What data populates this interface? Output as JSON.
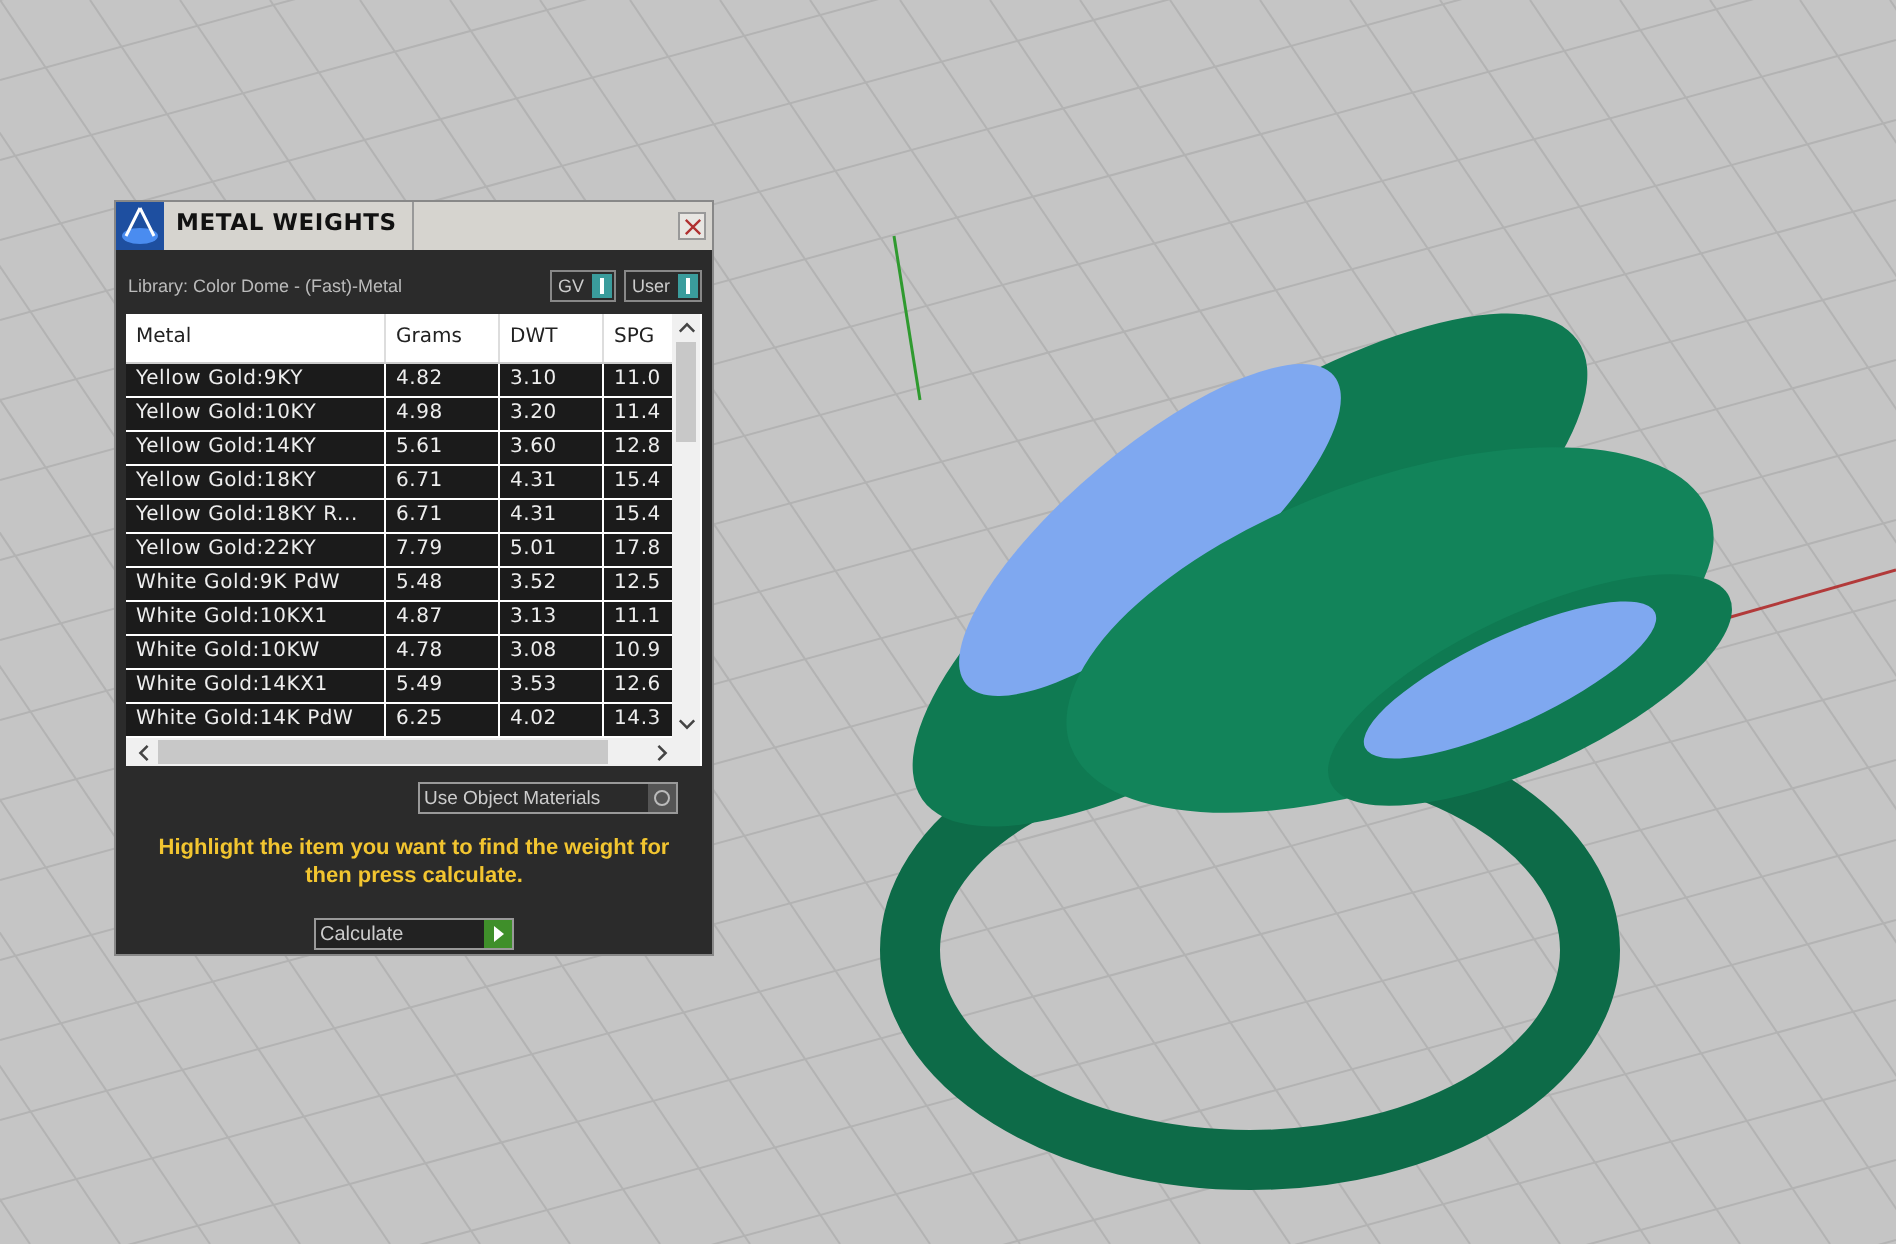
{
  "panel": {
    "title": "METAL WEIGHTS",
    "library": "Library: Color Dome - (Fast)-Metal",
    "toggles": [
      {
        "label": "GV",
        "on": true
      },
      {
        "label": "User",
        "on": true
      }
    ],
    "table": {
      "columns": [
        "Metal",
        "Grams",
        "DWT",
        "SPG"
      ],
      "rows": [
        {
          "metal": "Yellow Gold:9KY",
          "grams": "4.82",
          "dwt": "3.10",
          "spg": "11.0",
          "selected": false
        },
        {
          "metal": "Yellow Gold:10KY",
          "grams": "4.98",
          "dwt": "3.20",
          "spg": "11.4",
          "selected": false
        },
        {
          "metal": "Yellow Gold:14KY",
          "grams": "5.61",
          "dwt": "3.60",
          "spg": "12.8",
          "selected": false
        },
        {
          "metal": "Yellow Gold:18KY",
          "grams": "6.71",
          "dwt": "4.31",
          "spg": "15.4",
          "selected": false
        },
        {
          "metal": "Yellow Gold:18KY R...",
          "grams": "6.71",
          "dwt": "4.31",
          "spg": "15.4",
          "selected": false
        },
        {
          "metal": "Yellow Gold:22KY",
          "grams": "7.79",
          "dwt": "5.01",
          "spg": "17.8",
          "selected": false
        },
        {
          "metal": "White Gold:9K PdW",
          "grams": "5.48",
          "dwt": "3.52",
          "spg": "12.5",
          "selected": false
        },
        {
          "metal": "White Gold:10KX1",
          "grams": "4.87",
          "dwt": "3.13",
          "spg": "11.1",
          "selected": false
        },
        {
          "metal": "White Gold:10KW",
          "grams": "4.78",
          "dwt": "3.08",
          "spg": "10.9",
          "selected": false
        },
        {
          "metal": "White Gold:14KX1",
          "grams": "5.49",
          "dwt": "3.53",
          "spg": "12.6",
          "selected": false
        },
        {
          "metal": "White Gold:14K PdW",
          "grams": "6.25",
          "dwt": "4.02",
          "spg": "14.3",
          "selected": false
        }
      ]
    },
    "object_materials": {
      "label": "Use Object Materials",
      "on": false
    },
    "hint": "Highlight the item you want to find the weight for then press calculate.",
    "calculate": "Calculate"
  }
}
